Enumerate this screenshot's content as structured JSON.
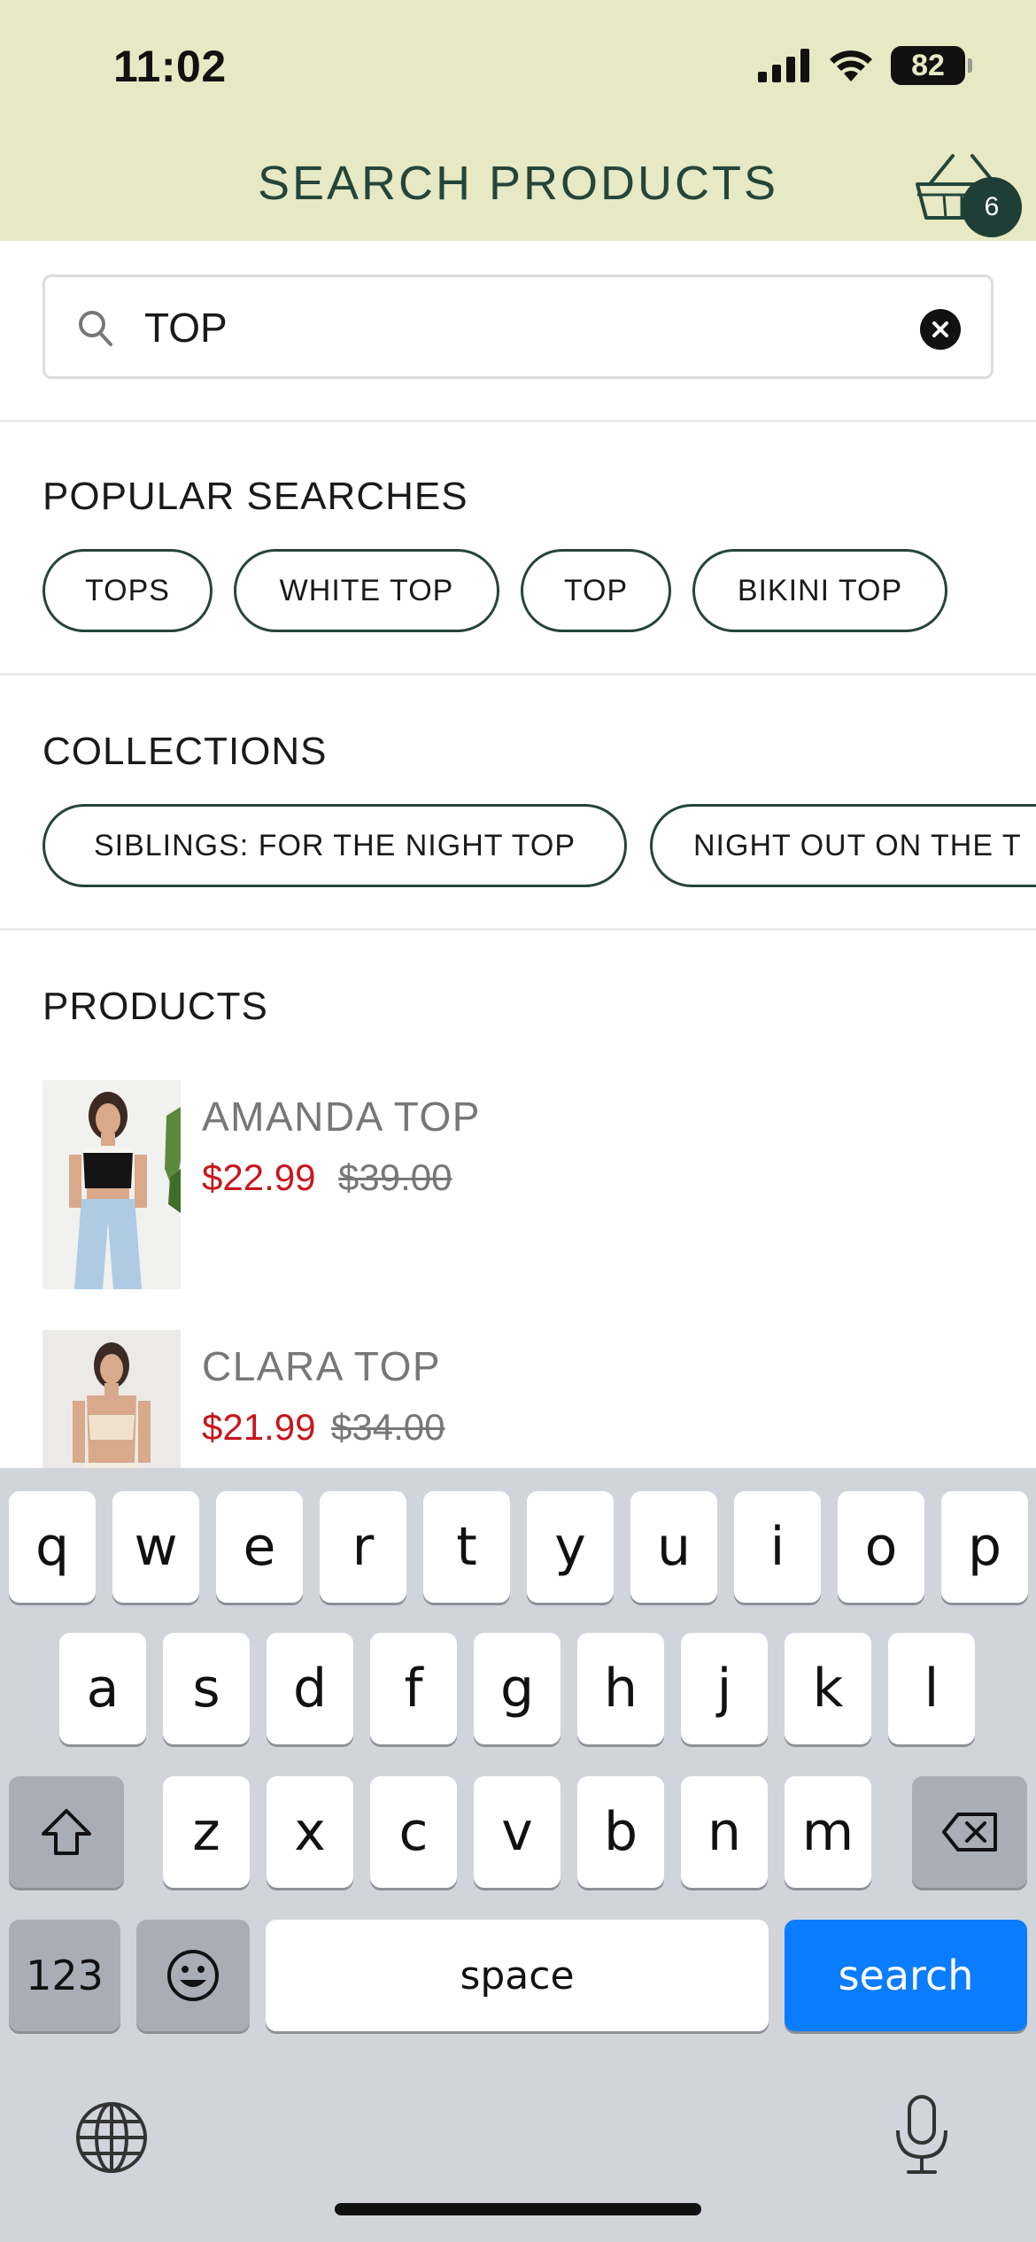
{
  "status_bar": {
    "time": "11:02",
    "battery": "82"
  },
  "header": {
    "title": "SEARCH PRODUCTS",
    "cart_count": "6"
  },
  "search": {
    "value": "TOP"
  },
  "popular": {
    "title": "POPULAR SEARCHES",
    "chips": [
      "TOPS",
      "WHITE TOP",
      "TOP",
      "BIKINI TOP"
    ]
  },
  "collections": {
    "title": "COLLECTIONS",
    "chips": [
      "SIBLINGS: FOR THE NIGHT TOP",
      "NIGHT OUT ON THE T"
    ]
  },
  "products": {
    "title": "PRODUCTS",
    "items": [
      {
        "name": "AMANDA TOP",
        "sale_price": "$22.99",
        "original_price": "$39.00"
      },
      {
        "name": "CLARA TOP",
        "sale_price": "$21.99",
        "original_price": "$34.00"
      }
    ]
  },
  "keyboard": {
    "row1": [
      "q",
      "w",
      "e",
      "r",
      "t",
      "y",
      "u",
      "i",
      "o",
      "p"
    ],
    "row2": [
      "a",
      "s",
      "d",
      "f",
      "g",
      "h",
      "j",
      "k",
      "l"
    ],
    "row3": [
      "z",
      "x",
      "c",
      "v",
      "b",
      "n",
      "m"
    ],
    "numbers_label": "123",
    "space_label": "space",
    "action_label": "search"
  },
  "colors": {
    "header_bg": "#e6e9c3",
    "brand_green": "#24453a",
    "sale_red": "#c8161d",
    "keyboard_bg": "#d1d4db",
    "action_blue": "#0a7cff"
  }
}
